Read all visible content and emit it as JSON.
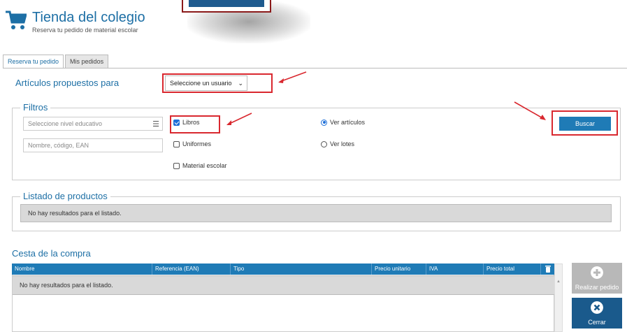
{
  "header": {
    "title": "Tienda del colegio",
    "subtitle": "Reserva tu pedido de material escolar",
    "icon": "shopping-cart-icon"
  },
  "tabs": [
    {
      "label": "Reserva tu pedido",
      "active": true
    },
    {
      "label": "Mis pedidos",
      "active": false
    }
  ],
  "proposed": {
    "title": "Artículos propuestos para",
    "select_value": "Seleccione un usuario"
  },
  "filters": {
    "legend": "Filtros",
    "level_placeholder": "Seleccione nivel educativo",
    "search_placeholder": "Nombre, código, EAN",
    "checkboxes": [
      {
        "label": "Libros",
        "checked": true
      },
      {
        "label": "Uniformes",
        "checked": false
      },
      {
        "label": "Material escolar",
        "checked": false
      }
    ],
    "radios": [
      {
        "label": "Ver artículos",
        "checked": true
      },
      {
        "label": "Ver lotes",
        "checked": false
      }
    ],
    "search_button": "Buscar"
  },
  "products": {
    "legend": "Listado de productos",
    "empty": "No hay resultados para el listado."
  },
  "cart": {
    "title": "Cesta de la compra",
    "columns": [
      "Nombre",
      "Referencia (EAN)",
      "Tipo",
      "Precio unitario",
      "IVA",
      "Precio total"
    ],
    "empty": "No hay resultados para el listado.",
    "actions": {
      "order": "Realizar pedido",
      "close": "Cerrar"
    }
  },
  "colors": {
    "accent": "#1d6fa5",
    "button": "#1f7bb6",
    "highlight": "#d9282f",
    "disabled": "#b8b8b8",
    "close_button": "#1a5a8c"
  }
}
